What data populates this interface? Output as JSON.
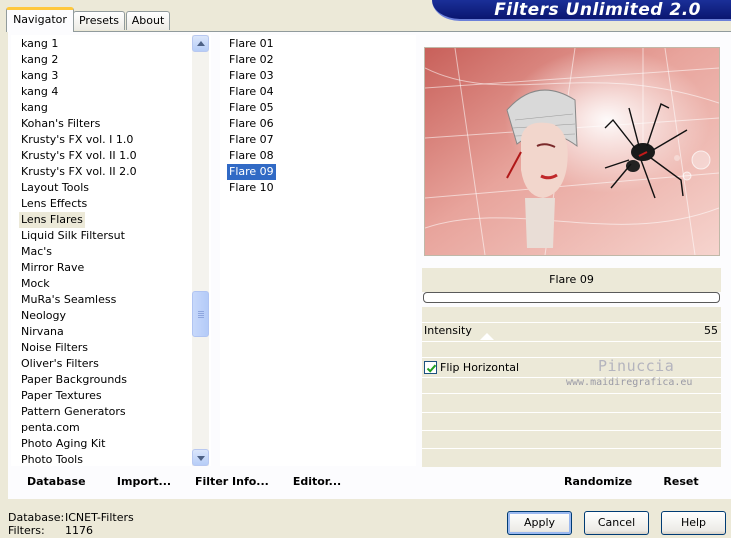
{
  "tabs": [
    "Navigator",
    "Presets",
    "About"
  ],
  "banner_title": "Filters Unlimited 2.0",
  "categories": [
    "kang 1",
    "kang 2",
    "kang 3",
    "kang 4",
    "kang",
    "Kohan's Filters",
    "Krusty's FX vol. I 1.0",
    "Krusty's FX vol. II 1.0",
    "Krusty's FX vol. II 2.0",
    "Layout Tools",
    "Lens Effects",
    "Lens Flares",
    "Liquid Silk Filtersut",
    "Mac's",
    "Mirror Rave",
    "Mock",
    "MuRa's Seamless",
    "Neology",
    "Nirvana",
    "Noise Filters",
    "Oliver's Filters",
    "Paper Backgrounds",
    "Paper Textures",
    "Pattern Generators",
    "penta.com",
    "Photo Aging Kit",
    "Photo Tools"
  ],
  "selected_category": "Lens Flares",
  "filters": [
    "Flare 01",
    "Flare 02",
    "Flare 03",
    "Flare 04",
    "Flare 05",
    "Flare 06",
    "Flare 07",
    "Flare 08",
    "Flare 09",
    "Flare 10"
  ],
  "selected_filter": "Flare 09",
  "controls": {
    "filter_name": "Flare 09",
    "intensity_label": "Intensity",
    "intensity_value": "55",
    "flip_label": "Flip Horizontal",
    "flip_checked": true
  },
  "watermark": {
    "name": "Pinuccia",
    "url": "www.maidiregrafica.eu"
  },
  "toolbar": {
    "database": "Database",
    "import": "Import...",
    "filter_info": "Filter Info...",
    "editor": "Editor...",
    "randomize": "Randomize",
    "reset": "Reset"
  },
  "status": {
    "database_label": "Database:",
    "database_value": "ICNET-Filters",
    "filters_label": "Filters:",
    "filters_value": "1176"
  },
  "buttons": {
    "apply": "Apply",
    "cancel": "Cancel",
    "help": "Help"
  }
}
